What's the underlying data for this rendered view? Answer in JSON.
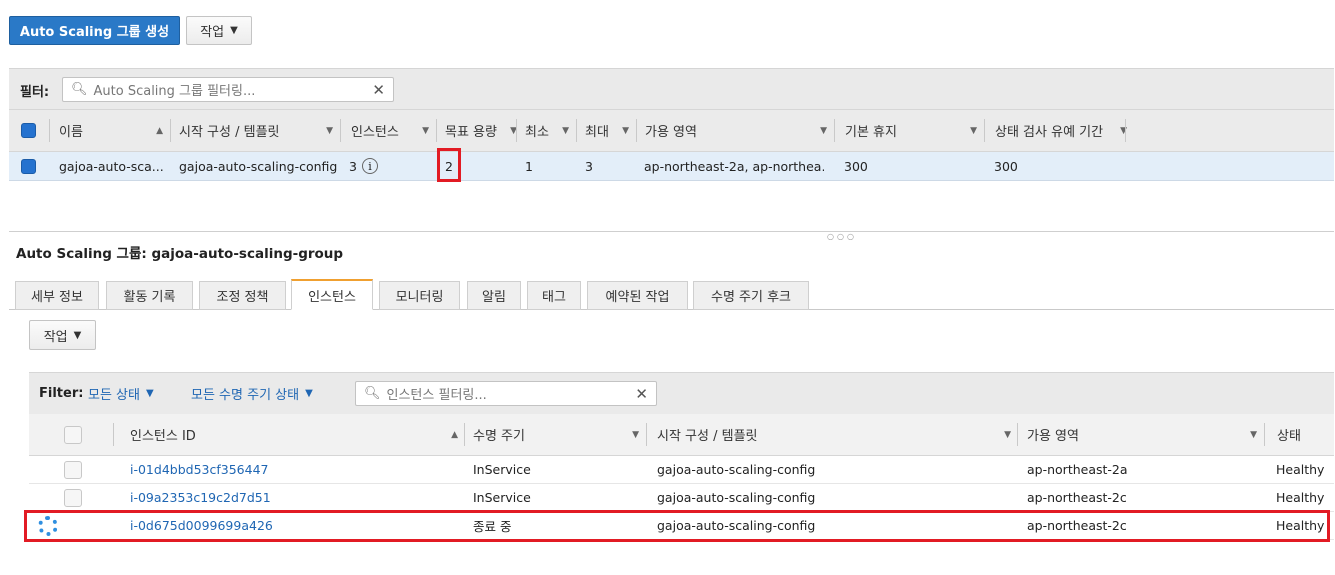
{
  "toolbar": {
    "create_label": "Auto Scaling 그룹 생성",
    "actions_label": "작업"
  },
  "filter": {
    "label": "필터:",
    "placeholder": "Auto Scaling 그룹 필터링..."
  },
  "groups_table": {
    "columns": [
      "이름",
      "시작 구성 / 템플릿",
      "인스턴스",
      "목표 용량",
      "최소",
      "최대",
      "가용 영역",
      "기본 휴지",
      "상태 검사 유예 기간"
    ],
    "row": {
      "name": "gajoa-auto-sca...",
      "launch_config": "gajoa-auto-scaling-config",
      "instances": "3",
      "desired": "2",
      "min": "1",
      "max": "3",
      "zones": "ap-northeast-2a, ap-northea...",
      "cooldown": "300",
      "grace": "300"
    }
  },
  "detail": {
    "title": "Auto Scaling 그룹: gajoa-auto-scaling-group",
    "tabs": [
      "세부 정보",
      "활동 기록",
      "조정 정책",
      "인스턴스",
      "모니터링",
      "알림",
      "태그",
      "예약된 작업",
      "수명 주기 후크"
    ],
    "active_tab": "인스턴스",
    "actions_label": "작업",
    "filter": {
      "label": "Filter:",
      "state": "모든 상태",
      "lifecycle": "모든 수명 주기 상태",
      "placeholder": "인스턴스 필터링..."
    },
    "columns": [
      "인스턴스 ID",
      "수명 주기",
      "시작 구성 / 템플릿",
      "가용 영역",
      "상태"
    ],
    "rows": [
      {
        "id": "i-01d4bbd53cf356447",
        "lifecycle": "InService",
        "config": "gajoa-auto-scaling-config",
        "zone": "ap-northeast-2a",
        "health": "Healthy"
      },
      {
        "id": "i-09a2353c19c2d7d51",
        "lifecycle": "InService",
        "config": "gajoa-auto-scaling-config",
        "zone": "ap-northeast-2c",
        "health": "Healthy"
      },
      {
        "id": "i-0d675d0099699a426",
        "lifecycle": "종료 중",
        "config": "gajoa-auto-scaling-config",
        "zone": "ap-northeast-2c",
        "health": "Healthy"
      }
    ]
  },
  "colors": {
    "primary": "#2a79c7",
    "link": "#1f66b3",
    "highlight": "#e21b24",
    "selected_row": "#e3eef9"
  }
}
